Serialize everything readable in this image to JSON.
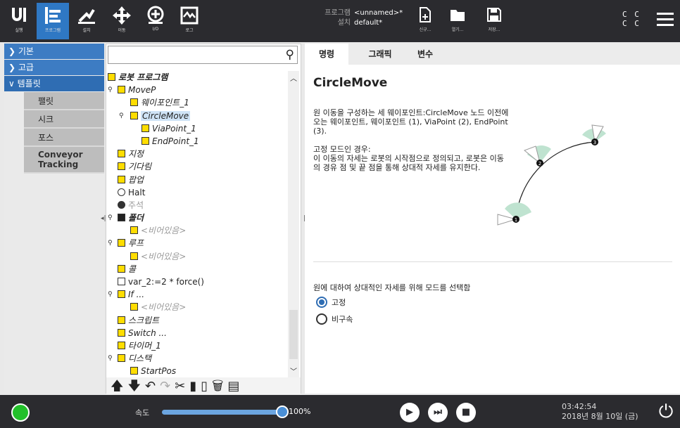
{
  "topbar": {
    "tabs": [
      {
        "label": "실행",
        "icon": "ur-logo-icon"
      },
      {
        "label": "프로그램",
        "icon": "program-icon"
      },
      {
        "label": "설치",
        "icon": "installation-icon"
      },
      {
        "label": "이동",
        "icon": "move-icon"
      },
      {
        "label": "I/O",
        "icon": "io-icon"
      },
      {
        "label": "로그",
        "icon": "log-icon"
      }
    ],
    "program_label": "프로그램",
    "program_value": "<unnamed>*",
    "install_label": "설치",
    "install_value": "default*",
    "file_buttons": [
      "신규...",
      "열기...",
      "저장..."
    ],
    "cc_lines": [
      "C C",
      "C C"
    ]
  },
  "sidebar": {
    "sections": [
      "기본",
      "고급",
      "템플릿"
    ],
    "items": [
      "팰릿",
      "시크",
      "포스",
      "Conveyor Tracking"
    ]
  },
  "tree": {
    "root": "로봇 프로그램",
    "nodes": [
      "MoveP",
      "웨이포인트_1",
      "CircleMove",
      "ViaPoint_1",
      "EndPoint_1",
      "지정",
      "기다림",
      "팝업",
      "Halt",
      "주석",
      "폴더",
      "<비어있음>",
      "루프",
      "<비어있음>",
      "콜",
      "var_2:=2 * force()",
      "If ...",
      "<비어있음>",
      "스크립트",
      "Switch ...",
      "타이머_1",
      "디스택",
      "StartPos"
    ]
  },
  "main": {
    "tabs": [
      "명령",
      "그래픽",
      "변수"
    ],
    "title": "CircleMove",
    "desc1": "원 이동을 구성하는 세 웨이포인트:CircleMove 노드 이전에 오는 웨이포인트, 웨이포인트 (1), ViaPoint (2), EndPoint (3).",
    "desc2_title": "고정 모드인 경우:",
    "desc2": "이 이동의 자세는 로봇의 시작점으로 정의되고, 로봇은 이동의 경유 점 및 끝 점을 통해 상대적 자세를 유지한다.",
    "mode_question": "원에 대하여 상대적인 자세를 위해 모드를 선택함",
    "modes": [
      "고정",
      "비구속"
    ],
    "selected_mode": "고정",
    "diagram_points": [
      "1",
      "2",
      "3"
    ]
  },
  "bottombar": {
    "speed_label": "속도",
    "speed_value": "100%",
    "speed_fraction": 1.0,
    "time": "03:42:54",
    "date": "2018년 8월 10일 (금)"
  },
  "colors": {
    "accent": "#2f6db3",
    "dark_bar": "#2b2b2f",
    "highlight": "#ffdd00",
    "running": "#22c02a"
  }
}
